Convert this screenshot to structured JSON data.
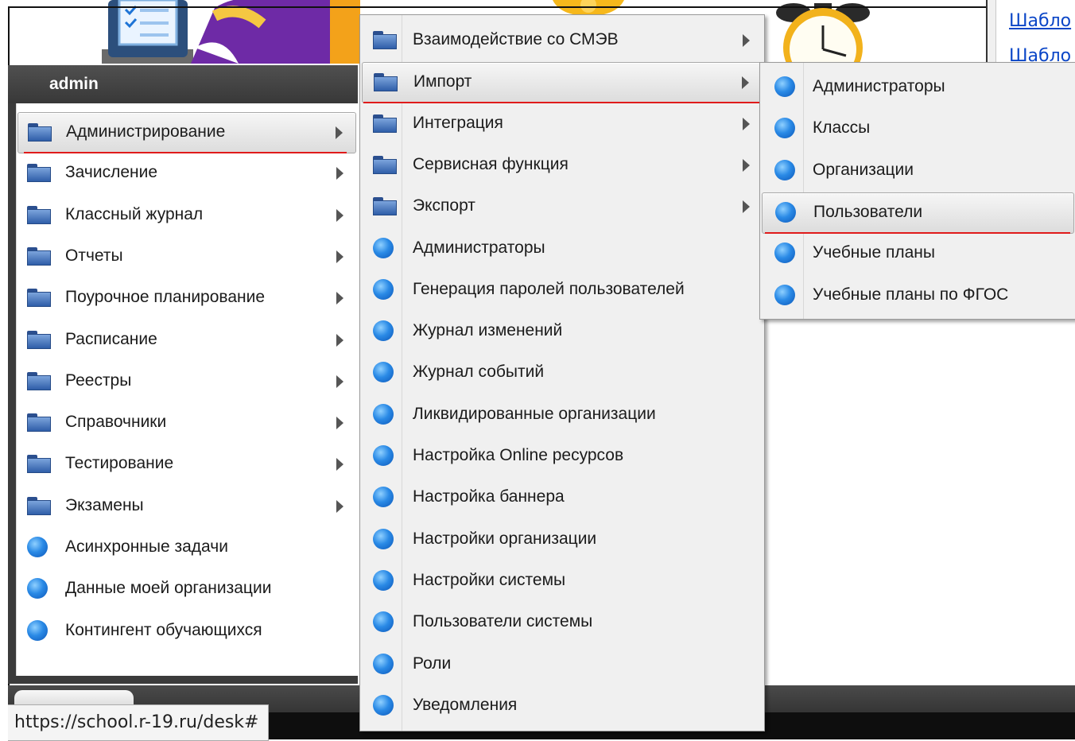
{
  "user": {
    "name": "admin"
  },
  "right_window": {
    "links": [
      "Шабло",
      "Шабло"
    ]
  },
  "status_bar": {
    "url": "https://school.r-19.ru/desk#"
  },
  "start_menu": {
    "items": [
      {
        "label": "Администрирование",
        "icon": "folder-icon",
        "submenu": true,
        "active": true
      },
      {
        "label": "Зачисление",
        "icon": "folder-icon",
        "submenu": true
      },
      {
        "label": "Классный журнал",
        "icon": "folder-icon",
        "submenu": true
      },
      {
        "label": "Отчеты",
        "icon": "folder-icon",
        "submenu": true
      },
      {
        "label": "Поурочное планирование",
        "icon": "folder-icon",
        "submenu": true
      },
      {
        "label": "Расписание",
        "icon": "folder-icon",
        "submenu": true
      },
      {
        "label": "Реестры",
        "icon": "folder-icon",
        "submenu": true
      },
      {
        "label": "Справочники",
        "icon": "folder-icon",
        "submenu": true
      },
      {
        "label": "Тестирование",
        "icon": "folder-icon",
        "submenu": true
      },
      {
        "label": "Экзамены",
        "icon": "folder-icon",
        "submenu": true
      },
      {
        "label": "Асинхронные задачи",
        "icon": "blue-ball-icon"
      },
      {
        "label": "Данные моей организации",
        "icon": "blue-ball-icon"
      },
      {
        "label": "Контингент обучающихся",
        "icon": "blue-ball-icon"
      }
    ]
  },
  "admin_menu": {
    "items": [
      {
        "label": "Взаимодействие со СМЭВ",
        "icon": "folder-icon",
        "submenu": true
      },
      {
        "label": "Импорт",
        "icon": "folder-icon",
        "submenu": true,
        "active": true
      },
      {
        "label": "Интеграция",
        "icon": "folder-icon",
        "submenu": true
      },
      {
        "label": "Сервисная функция",
        "icon": "folder-icon",
        "submenu": true
      },
      {
        "label": "Экспорт",
        "icon": "folder-icon",
        "submenu": true
      },
      {
        "label": "Администраторы",
        "icon": "blue-ball-icon"
      },
      {
        "label": "Генерация паролей пользователей",
        "icon": "blue-ball-icon"
      },
      {
        "label": "Журнал изменений",
        "icon": "blue-ball-icon"
      },
      {
        "label": "Журнал событий",
        "icon": "blue-ball-icon"
      },
      {
        "label": "Ликвидированные организации",
        "icon": "blue-ball-icon"
      },
      {
        "label": "Настройка Online ресурсов",
        "icon": "blue-ball-icon"
      },
      {
        "label": "Настройка баннера",
        "icon": "blue-ball-icon"
      },
      {
        "label": "Настройки организации",
        "icon": "blue-ball-icon"
      },
      {
        "label": "Настройки системы",
        "icon": "blue-ball-icon"
      },
      {
        "label": "Пользователи системы",
        "icon": "blue-ball-icon"
      },
      {
        "label": "Роли",
        "icon": "blue-ball-icon"
      },
      {
        "label": "Уведомления",
        "icon": "blue-ball-icon"
      }
    ]
  },
  "import_menu": {
    "items": [
      {
        "label": "Администраторы",
        "icon": "blue-ball-icon"
      },
      {
        "label": "Классы",
        "icon": "blue-ball-icon"
      },
      {
        "label": "Организации",
        "icon": "blue-ball-icon"
      },
      {
        "label": "Пользователи",
        "icon": "blue-ball-icon",
        "active": true
      },
      {
        "label": "Учебные планы",
        "icon": "blue-ball-icon"
      },
      {
        "label": "Учебные планы по ФГОС",
        "icon": "blue-ball-icon"
      }
    ]
  },
  "colors": {
    "accent_line": "#e01b1b",
    "link": "#0b46c7",
    "menu_bg": "#f0f0f0",
    "panel_dark": "#3b3b3b"
  }
}
